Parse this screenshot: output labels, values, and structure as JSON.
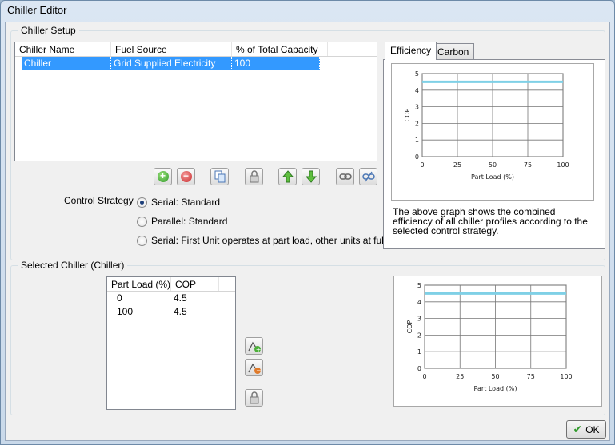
{
  "window": {
    "title": "Chiller Editor"
  },
  "setup": {
    "group_title": "Chiller Setup",
    "columns": [
      "Chiller Name",
      "Fuel Source",
      "% of Total Capacity"
    ],
    "rows": [
      {
        "name": "Chiller",
        "fuel": "Grid Supplied Electricity",
        "capacity": "100"
      }
    ],
    "control_label": "Control Strategy",
    "strategies": [
      {
        "label": "Serial: Standard",
        "checked": true
      },
      {
        "label": "Parallel: Standard",
        "checked": false
      },
      {
        "label": "Serial: First Unit operates at part load, other units at full",
        "checked": false
      }
    ]
  },
  "tabs": [
    {
      "label": "Efficiency",
      "active": true
    },
    {
      "label": "Carbon",
      "active": false
    }
  ],
  "efficiency_desc": "The above graph shows the combined efficiency of all chiller profiles according to the selected control strategy.",
  "selected": {
    "group_title": "Selected Chiller (Chiller)",
    "columns": [
      "Part Load (%)",
      "COP"
    ],
    "rows": [
      {
        "load": "0",
        "cop": "4.5"
      },
      {
        "load": "100",
        "cop": "4.5"
      }
    ]
  },
  "ok_label": "OK",
  "chart_data": [
    {
      "type": "line",
      "x": [
        0,
        100
      ],
      "series": [
        {
          "values": [
            4.5,
            4.5
          ]
        }
      ],
      "xlabel": "Part Load (%)",
      "ylabel": "COP",
      "xlim": [
        0,
        100
      ],
      "ylim": [
        0,
        5
      ],
      "xticks": [
        0,
        25,
        50,
        75,
        100
      ],
      "yticks": [
        0,
        1,
        2,
        3,
        4,
        5
      ],
      "grid": true,
      "line_color": "#7fd0e6"
    },
    {
      "type": "line",
      "x": [
        0,
        100
      ],
      "series": [
        {
          "values": [
            4.5,
            4.5
          ]
        }
      ],
      "xlabel": "Part Load (%)",
      "ylabel": "COP",
      "xlim": [
        0,
        100
      ],
      "ylim": [
        0,
        5
      ],
      "xticks": [
        0,
        25,
        50,
        75,
        100
      ],
      "yticks": [
        0,
        1,
        2,
        3,
        4,
        5
      ],
      "grid": true,
      "line_color": "#7fd0e6"
    }
  ]
}
